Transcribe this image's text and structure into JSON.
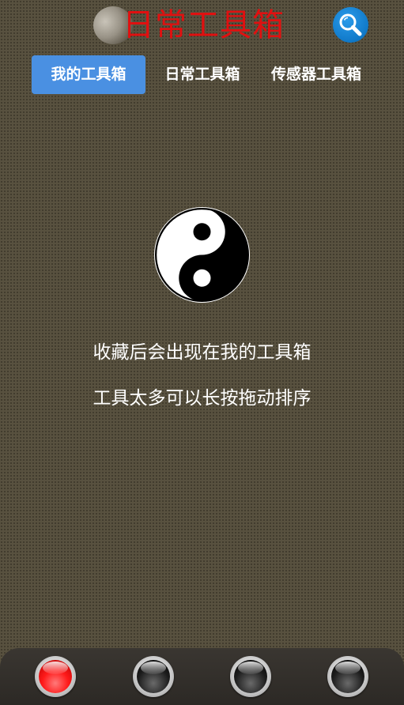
{
  "header": {
    "title": "日常工具箱",
    "moon_icon": "moon-icon",
    "search_icon": "search-icon",
    "accent_color": "#1079c9",
    "title_color": "#e01010"
  },
  "tabs": [
    {
      "label": "我的工具箱",
      "active": true
    },
    {
      "label": "日常工具箱",
      "active": false
    },
    {
      "label": "传感器工具箱",
      "active": false
    }
  ],
  "empty_state": {
    "icon": "yin-yang-icon",
    "line1": "收藏后会出现在我的工具箱",
    "line2": "工具太多可以长按拖动排序"
  },
  "bottom_nav": {
    "items": [
      {
        "icon": "red-orb-icon",
        "active": true
      },
      {
        "icon": "black-orb-icon",
        "active": false
      },
      {
        "icon": "black-orb-icon",
        "active": false
      },
      {
        "icon": "black-orb-icon",
        "active": false
      }
    ]
  },
  "colors": {
    "background": "#58513f",
    "tab_active": "#4a90e2",
    "bottom_bar": "#2c2925"
  }
}
